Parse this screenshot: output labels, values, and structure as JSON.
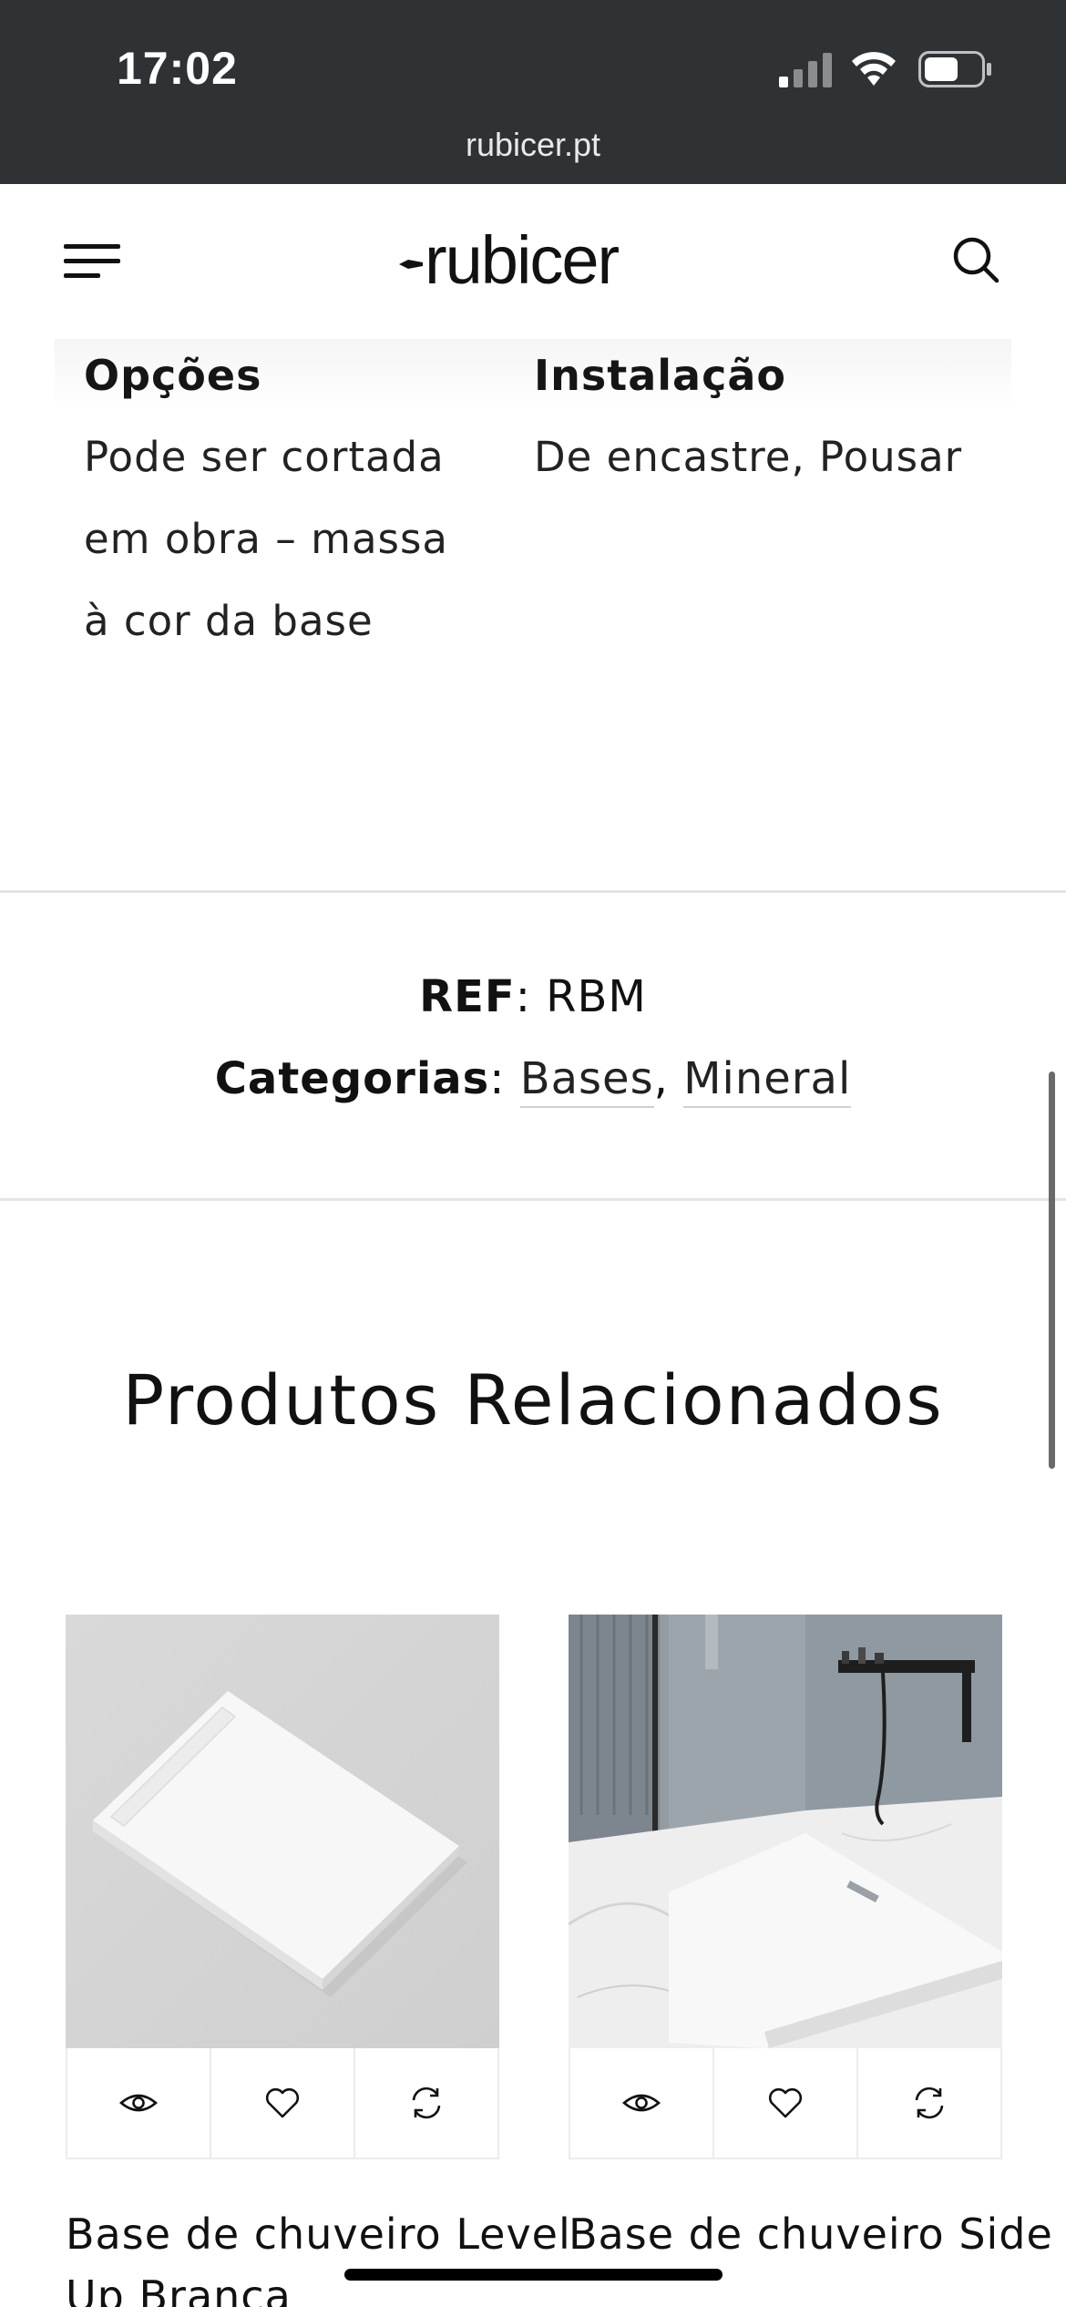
{
  "status_bar": {
    "time": "17:02",
    "url": "rubicer.pt"
  },
  "header": {
    "logo_text": "rubicer"
  },
  "attributes": [
    {
      "label": "Opções",
      "value_lines": [
        "Pode ser cortada",
        "em obra – massa",
        "à cor da base"
      ]
    },
    {
      "label": "Instalação",
      "value_lines": [
        "De encastre, Pousar"
      ]
    }
  ],
  "meta": {
    "ref_label": "REF",
    "ref_value": "RBM",
    "categories_label": "Categorias",
    "categories": [
      "Bases",
      "Mineral"
    ]
  },
  "related": {
    "title": "Produtos Relacionados",
    "products": [
      {
        "name_lines": [
          "Base de chuveiro Level",
          "Up Branca"
        ]
      },
      {
        "name_lines": [
          "Base de chuveiro Side"
        ]
      }
    ]
  }
}
